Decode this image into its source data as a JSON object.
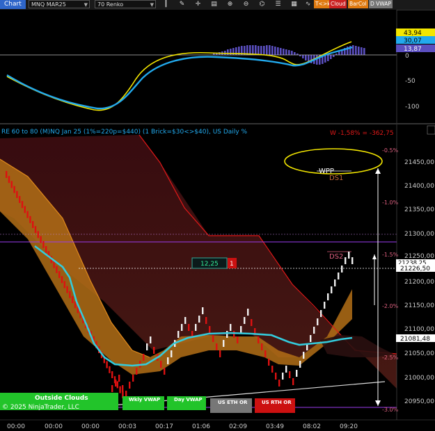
{
  "toolbar": {
    "chart_tab": "Chart",
    "instrument": "MNQ MAR25",
    "bar_type": "70 Renko",
    "buttons": [
      {
        "label": "T<>k",
        "color": "#e07a10"
      },
      {
        "label": "Cloud",
        "color": "#cc2222"
      },
      {
        "label": "BarCol",
        "color": "#e07a10"
      },
      {
        "label": "D VWAP",
        "color": "#777777"
      }
    ]
  },
  "osc_panel": {
    "ticks": [
      "0",
      "-50",
      "-100"
    ],
    "badges": [
      {
        "label": "43,94",
        "color": "#f3e600",
        "text_color": "#000"
      },
      {
        "label": "30,07",
        "color": "#22aaee",
        "text_color": "#000"
      },
      {
        "label": "13,87",
        "color": "#6a5acd",
        "text_color": "#fff"
      }
    ]
  },
  "main_panel": {
    "header": "RE 60 to 80 (M)NQ Jan 25 (1%=220p=$440) (1 Brick=$30<>$40), US Daily %",
    "daily_change": "W -1,58% = -362,75",
    "price_ticks": [
      "21450,00",
      "21400,00",
      "21350,00",
      "21300,00",
      "21250,00",
      "21200,00",
      "21150,00",
      "21100,00",
      "21050,00",
      "21000,00",
      "20950,00"
    ],
    "pct_labels": [
      "-0.5%",
      "-1.0%",
      "-1.5%",
      "-2.0%",
      "-2.5%",
      "-3.0%"
    ],
    "price_badges": [
      {
        "label": "21238,25",
        "color": "#ffffff"
      },
      {
        "label": "21226,50",
        "color": "#ffffff"
      },
      {
        "label": "21081,48",
        "color": "#ffffff"
      }
    ],
    "levels": {
      "wpp": "WPP",
      "ds1": "DS1",
      "ds2": "DS2"
    },
    "position": {
      "quantity": "12,25",
      "count": "1"
    },
    "copyright": "© 2025 NinjaTrader, LLC",
    "bottom_buttons": [
      {
        "label": "Outside Clouds",
        "color": "#22c42a"
      },
      {
        "label": "Wkly VWAP",
        "color": "#22c42a"
      },
      {
        "label": "Day VWAP",
        "color": "#22c42a"
      },
      {
        "label": "US ETH OR",
        "color": "#777777"
      },
      {
        "label": "US RTH OR",
        "color": "#cc1111"
      }
    ],
    "time_labels": [
      "00:00",
      "00:00",
      "00:00",
      "00:03",
      "00:17",
      "01:06",
      "02:09",
      "03:49",
      "08:02",
      "09:20"
    ]
  },
  "colors": {
    "cloud_orange": "#c8781a",
    "cloud_red": "#5a1a1a",
    "brick_red": "#dd1111",
    "brick_white": "#f0f0f0",
    "vwap_cyan": "#33ccdd",
    "osc_yellow": "#f3e600",
    "osc_blue": "#22aaee",
    "histogram": "#6a5acd"
  }
}
